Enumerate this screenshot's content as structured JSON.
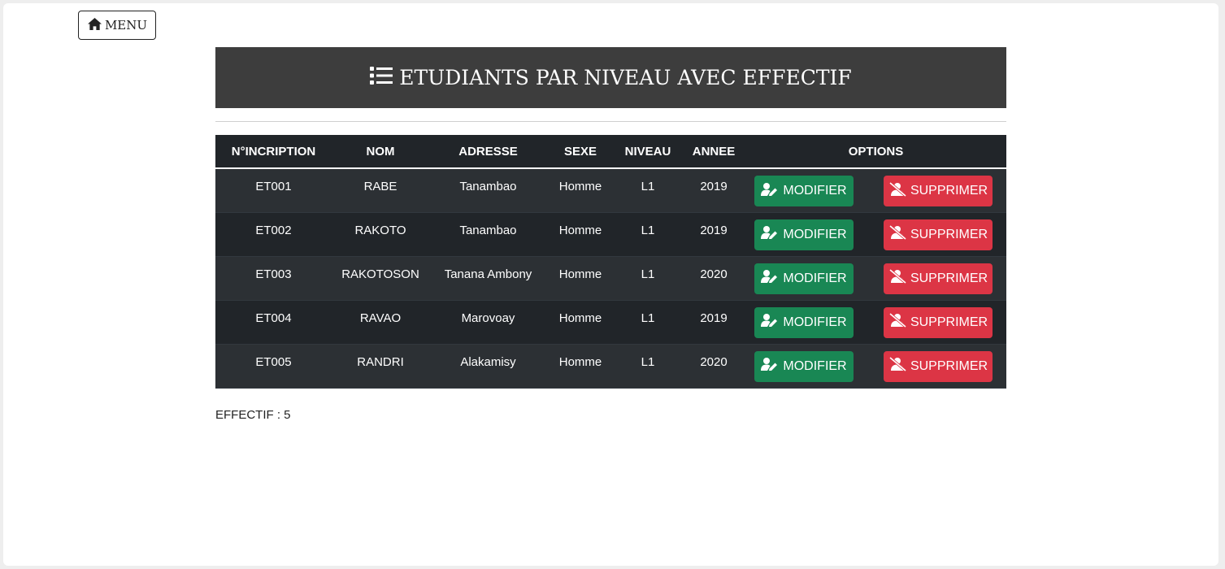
{
  "menu": {
    "label": "MENU",
    "icon": "home-icon"
  },
  "title": {
    "text": "ETUDIANTS PAR NIVEAU AVEC EFFECTIF",
    "icon": "list-icon"
  },
  "table": {
    "headers": [
      "N°INCRIPTION",
      "NOM",
      "ADRESSE",
      "SEXE",
      "NIVEAU",
      "ANNEE",
      "OPTIONS"
    ],
    "rows": [
      {
        "num": "ET001",
        "nom": "RABE",
        "adresse": "Tanambao",
        "sexe": "Homme",
        "niveau": "L1",
        "annee": "2019"
      },
      {
        "num": "ET002",
        "nom": "RAKOTO",
        "adresse": "Tanambao",
        "sexe": "Homme",
        "niveau": "L1",
        "annee": "2019"
      },
      {
        "num": "ET003",
        "nom": "RAKOTOSON",
        "adresse": "Tanana Ambony",
        "sexe": "Homme",
        "niveau": "L1",
        "annee": "2020"
      },
      {
        "num": "ET004",
        "nom": "RAVAO",
        "adresse": "Marovoay",
        "sexe": "Homme",
        "niveau": "L1",
        "annee": "2019"
      },
      {
        "num": "ET005",
        "nom": "RANDRI",
        "adresse": "Alakamisy",
        "sexe": "Homme",
        "niveau": "L1",
        "annee": "2020"
      }
    ],
    "buttons": {
      "edit_label": "MODIFIER",
      "edit_icon": "user-edit-icon",
      "edit_color": "#198754",
      "delete_label": "SUPPRIMER",
      "delete_icon": "user-remove-icon",
      "delete_color": "#dc3545"
    }
  },
  "effectif": {
    "text": "EFFECTIF : 5"
  },
  "colors": {
    "header_bg": "#3d3d3d",
    "table_dark": "#212529",
    "table_stripe": "#2c3034"
  }
}
